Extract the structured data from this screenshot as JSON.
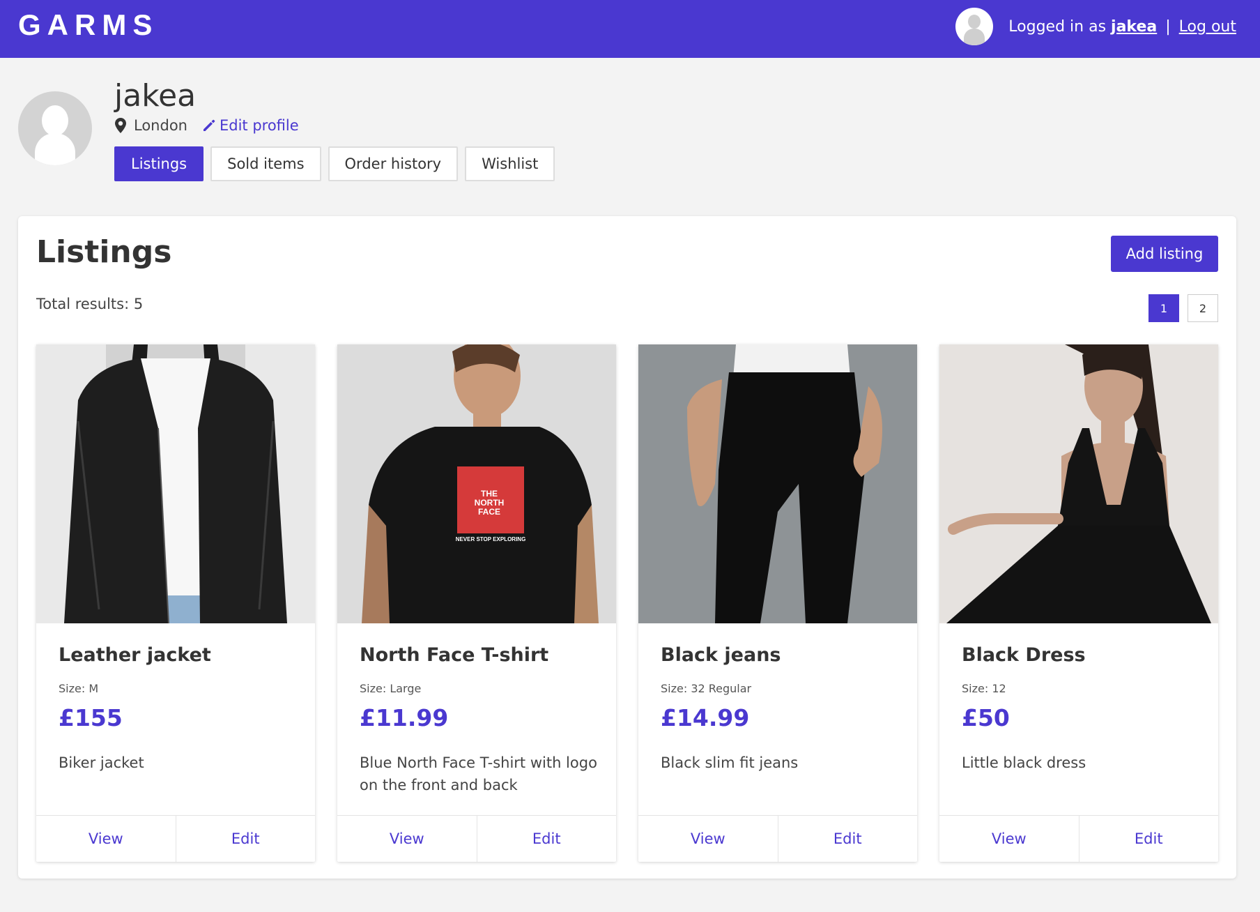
{
  "brand": {
    "logo": "GARMS",
    "accent": "#4a38d0"
  },
  "header": {
    "logged_in_prefix": "Logged in as",
    "username": "jakea",
    "separator": "|",
    "logout_label": "Log out"
  },
  "profile": {
    "username": "jakea",
    "location": "London",
    "edit_label": "Edit profile",
    "tabs": [
      {
        "label": "Listings",
        "active": true
      },
      {
        "label": "Sold items",
        "active": false
      },
      {
        "label": "Order history",
        "active": false
      },
      {
        "label": "Wishlist",
        "active": false
      }
    ]
  },
  "listings": {
    "title": "Listings",
    "add_label": "Add listing",
    "total_text": "Total results: 5",
    "pages": [
      "1",
      "2"
    ],
    "current_page": "1",
    "items": [
      {
        "title": "Leather jacket",
        "size": "Size: M",
        "price": "£155",
        "description": "Biker jacket",
        "view_label": "View",
        "edit_label": "Edit",
        "image": "leather-jacket-photo"
      },
      {
        "title": "North Face T-shirt",
        "size": "Size: Large",
        "price": "£11.99",
        "description": "Blue North Face T-shirt with logo on the front and back",
        "view_label": "View",
        "edit_label": "Edit",
        "image": "north-face-tshirt-photo",
        "logo_lines": [
          "THE",
          "NORTH",
          "FACE"
        ],
        "tagline": "NEVER STOP EXPLORING"
      },
      {
        "title": "Black jeans",
        "size": "Size: 32 Regular",
        "price": "£14.99",
        "description": "Black slim fit jeans",
        "view_label": "View",
        "edit_label": "Edit",
        "image": "black-jeans-photo"
      },
      {
        "title": "Black Dress",
        "size": "Size: 12",
        "price": "£50",
        "description": "Little black dress",
        "view_label": "View",
        "edit_label": "Edit",
        "image": "black-dress-photo"
      }
    ]
  }
}
